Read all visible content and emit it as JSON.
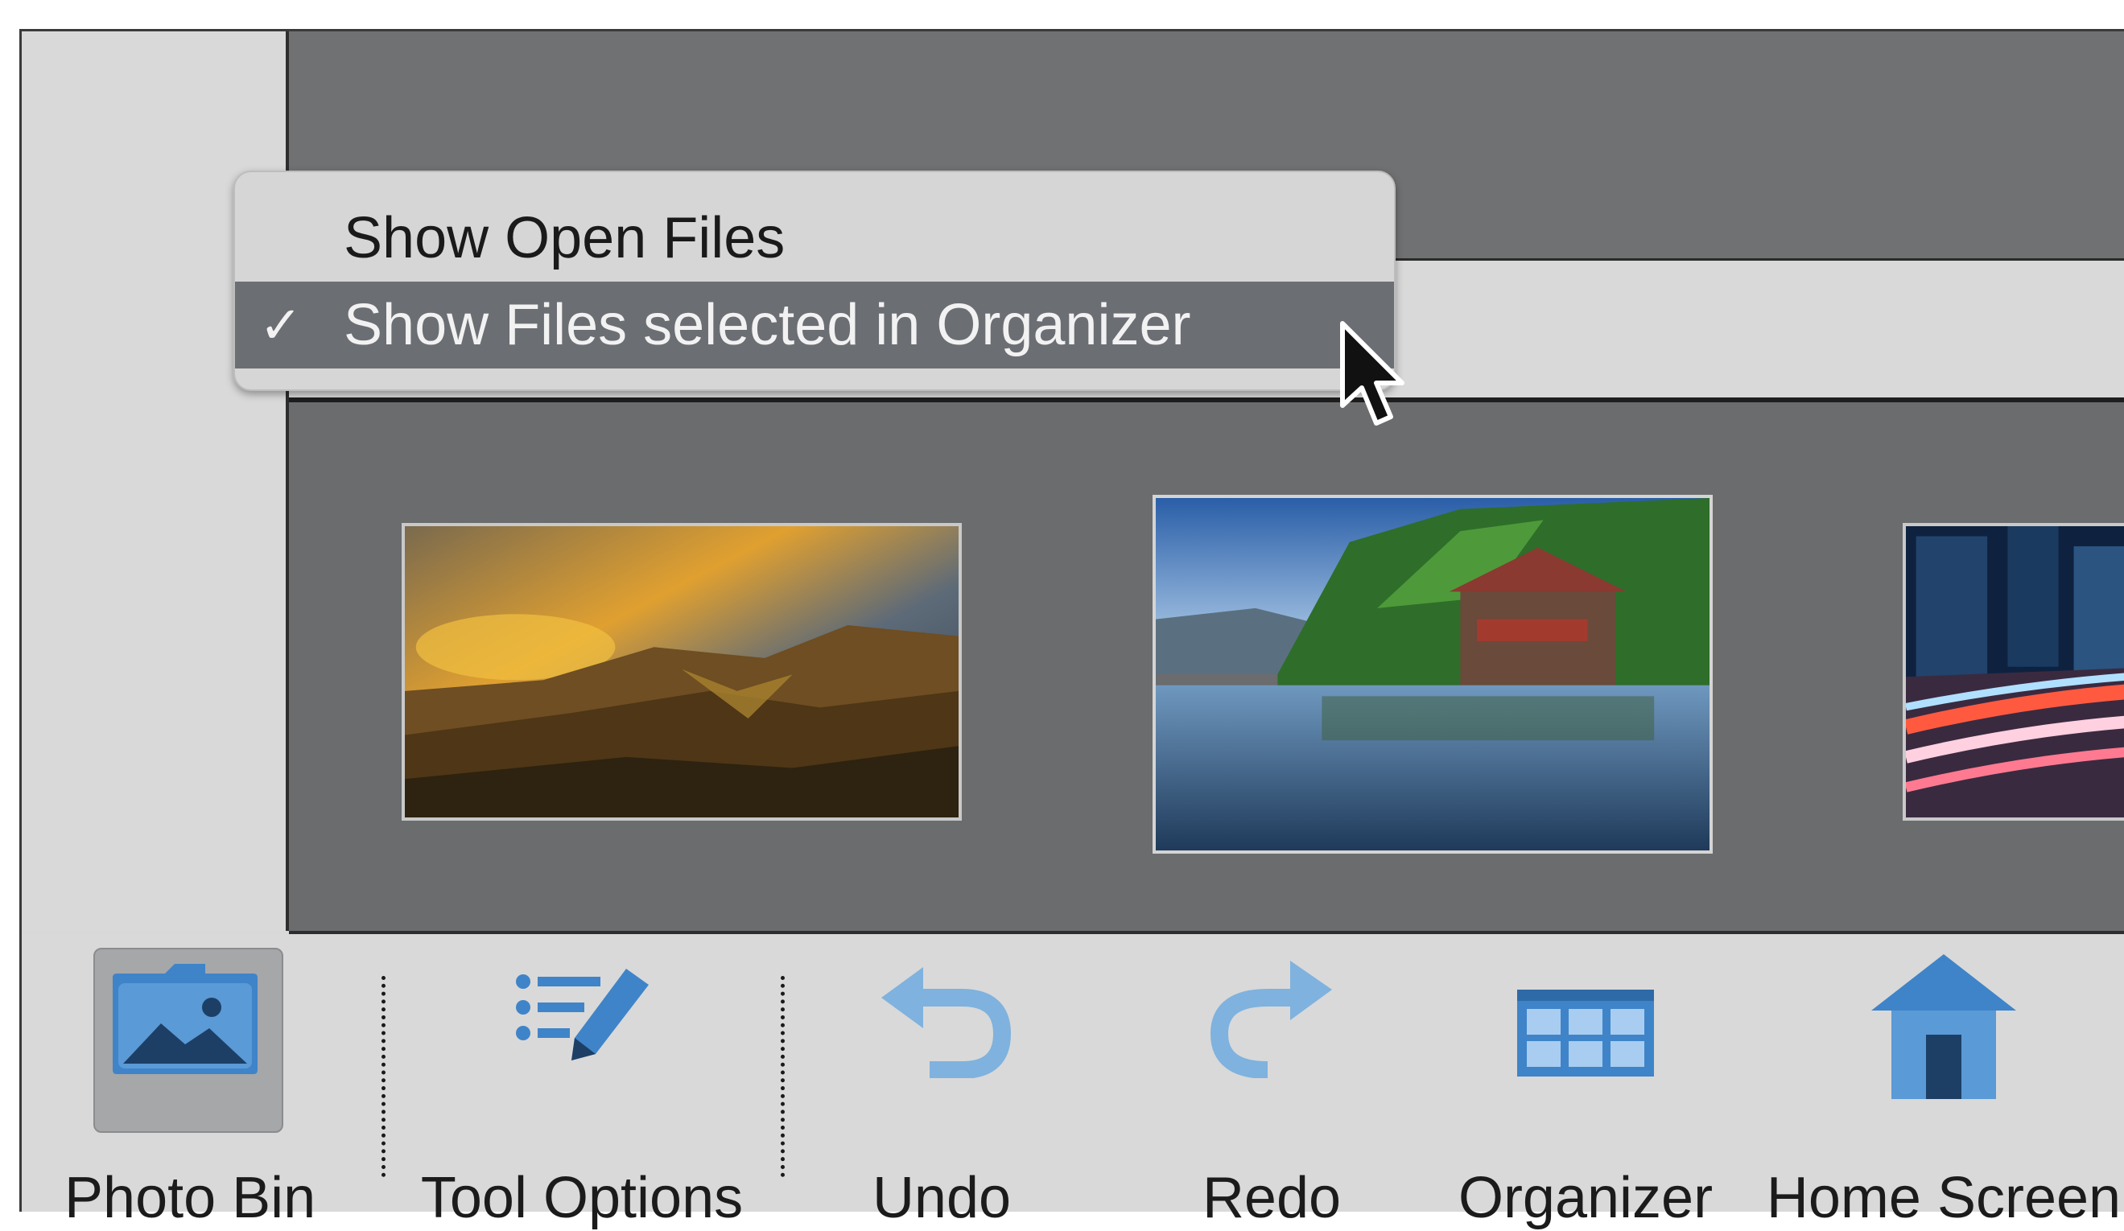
{
  "menu": {
    "items": [
      {
        "label": "Show Open Files",
        "checked": false
      },
      {
        "label": "Show Files selected in Organizer",
        "checked": true,
        "check_mark": "✓"
      }
    ]
  },
  "photo_bin": {
    "thumbnails": [
      {
        "name": "sunset-cliffs-photo",
        "selected": false
      },
      {
        "name": "lake-boathouse-photo",
        "selected": true
      },
      {
        "name": "city-night-lights-photo",
        "selected": false
      }
    ]
  },
  "taskbar": {
    "photo_bin_label": "Photo Bin",
    "tool_options_label": "Tool Options",
    "undo_label": "Undo",
    "redo_label": "Redo",
    "organizer_label": "Organizer",
    "home_screen_label": "Home Screen"
  },
  "colors": {
    "icon_blue": "#3f84c8",
    "icon_light_blue": "#7fb2de",
    "menu_highlight": "#6b6e73",
    "panel_dark": "#6a6c6e"
  }
}
